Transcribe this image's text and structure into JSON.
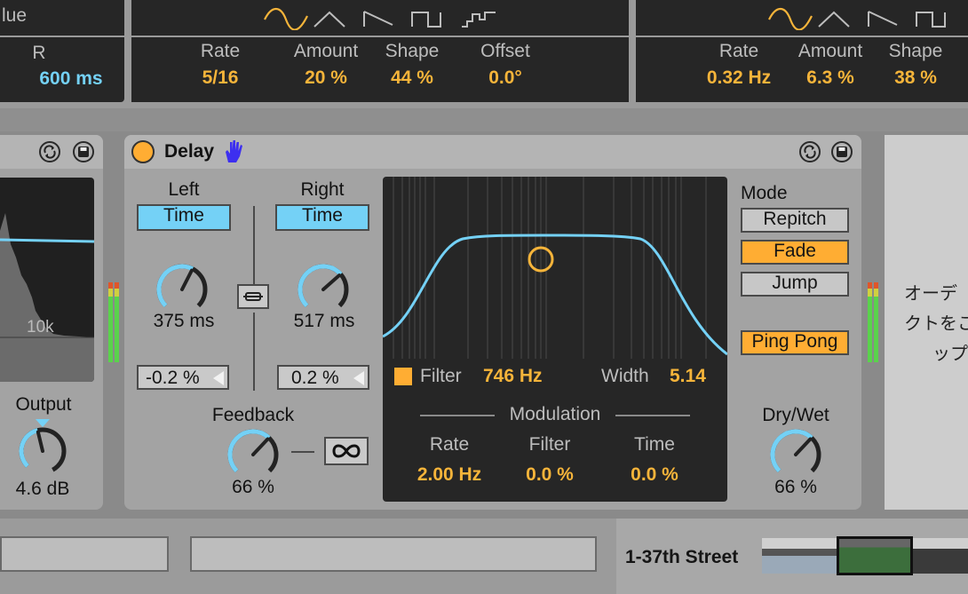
{
  "top_left": {
    "cut_label": "lue",
    "r_label": "R",
    "r_value": "600 ms"
  },
  "lfo1": {
    "params": [
      {
        "label": "Rate",
        "value": "5/16"
      },
      {
        "label": "Amount",
        "value": "20 %"
      },
      {
        "label": "Shape",
        "value": "44 %"
      },
      {
        "label": "Offset",
        "value": "0.0°"
      }
    ]
  },
  "lfo2": {
    "params": [
      {
        "label": "Rate",
        "value": "0.32 Hz"
      },
      {
        "label": "Amount",
        "value": "6.3 %"
      },
      {
        "label": "Shape",
        "value": "38 %"
      }
    ]
  },
  "eq_left": {
    "freq_label": "10k",
    "output_label": "Output",
    "output_value": "4.6 dB",
    "output_level": 0.45
  },
  "delay": {
    "title": "Delay",
    "left": {
      "label": "Left",
      "mode": "Time",
      "time": "375 ms",
      "offset": "-0.2 %",
      "knob_level": 0.6
    },
    "right": {
      "label": "Right",
      "mode": "Time",
      "time": "517 ms",
      "offset": "0.2 %",
      "knob_level": 0.68
    },
    "feedback": {
      "label": "Feedback",
      "value": "66 %",
      "level": 0.66
    },
    "filter": {
      "label": "Filter",
      "value": "746 Hz",
      "width_label": "Width",
      "width_value": "5.14"
    },
    "modulation": {
      "title": "Modulation",
      "params": [
        {
          "label": "Rate",
          "value": "2.00 Hz"
        },
        {
          "label": "Filter",
          "value": "0.0 %"
        },
        {
          "label": "Time",
          "value": "0.0 %"
        }
      ]
    },
    "mode": {
      "label": "Mode",
      "options": [
        "Repitch",
        "Fade",
        "Jump"
      ],
      "selected": "Fade"
    },
    "ping_pong": "Ping Pong",
    "drywet": {
      "label": "Dry/Wet",
      "value": "66 %",
      "level": 0.66
    }
  },
  "info_text": [
    "オーデ",
    "クトをこ",
    "ップ"
  ],
  "bottom": {
    "clip_name": "1-37th Street"
  },
  "colors": {
    "accent_orange": "#f5b43a",
    "accent_cyan": "#74d1f6",
    "panel": "#a3a3a3",
    "dark": "#262626"
  }
}
